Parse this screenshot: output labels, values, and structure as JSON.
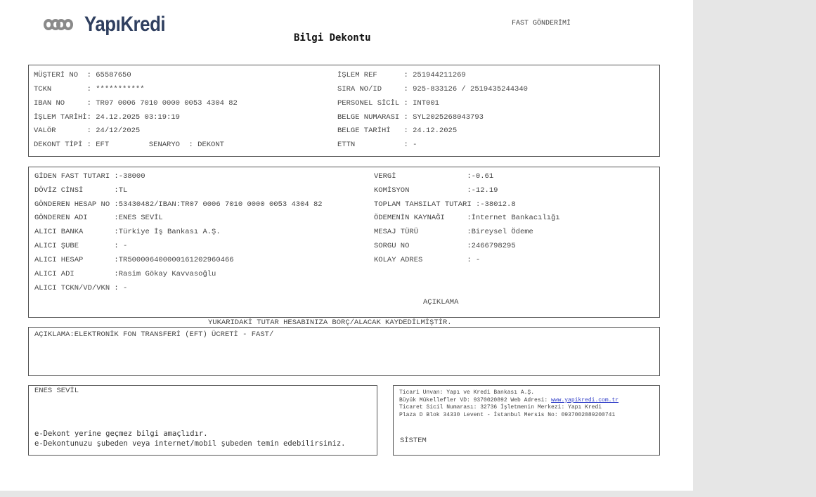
{
  "header": {
    "logo_text": "YapıKredi",
    "title": "Bilgi Dekontu",
    "doc_type": "FAST GÖNDERİMİ"
  },
  "customer": {
    "left": [
      {
        "label": "MÜŞTERİ NO  ",
        "value": ": 65587650"
      },
      {
        "label": "TCKN        ",
        "value": ": ***********"
      },
      {
        "label": "IBAN NO     ",
        "value": ": TR07 0006 7010 0000 0053 4304 82"
      },
      {
        "label": "İŞLEM TARİHİ",
        "value": ": 24.12.2025 03:19:19"
      },
      {
        "label": "VALÖR       ",
        "value": ": 24/12/2025"
      },
      {
        "label": "DEKONT TİPİ ",
        "value": ": EFT         SENARYO  : DEKONT"
      }
    ],
    "right": [
      {
        "label": "İŞLEM REF      ",
        "value": ": 251944211269"
      },
      {
        "label": "SIRA NO/ID     ",
        "value": ": 925-833126 / 2519435244340"
      },
      {
        "label": "PERSONEL SİCİL ",
        "value": ": INT001"
      },
      {
        "label": "BELGE NUMARASI ",
        "value": ": SYL2025268043793"
      },
      {
        "label": "BELGE TARİHİ   ",
        "value": ": 24.12.2025"
      },
      {
        "label": "ETTN           ",
        "value": ": -"
      }
    ]
  },
  "transfer": {
    "left": [
      {
        "label": "GİDEN FAST TUTARI ",
        "value": ":-38000"
      },
      {
        "label": "DÖVİZ CİNSİ       ",
        "value": ":TL"
      },
      {
        "label": "GÖNDEREN HESAP NO ",
        "value": ":53430482/IBAN:TR07 0006 7010 0000 0053 4304 82"
      },
      {
        "label": "GÖNDEREN ADI      ",
        "value": ":ENES SEVİL"
      },
      {
        "label": "ALICI BANKA       ",
        "value": ":Türkiye İş Bankası A.Ş."
      },
      {
        "label": "ALICI ŞUBE        ",
        "value": ": -"
      },
      {
        "label": "ALICI HESAP       ",
        "value": ":TR500006400000161202960466"
      },
      {
        "label": "ALICI ADI         ",
        "value": ":Rasim Gökay Kavvasoğlu"
      },
      {
        "label": "ALICI TCKN/VD/VKN ",
        "value": ": -"
      }
    ],
    "right": [
      {
        "label": "VERGİ                ",
        "value": ":-0.61"
      },
      {
        "label": "KOMİSYON             ",
        "value": ":-12.19"
      },
      {
        "label": "TOPLAM TAHSILAT TUTARI ",
        "value": ":-38012.8"
      },
      {
        "label": "ÖDEMENİN KAYNAĞI     ",
        "value": ":İnternet Bankacılığı"
      },
      {
        "label": "MESAJ TÜRÜ           ",
        "value": ":Bireysel Ödeme"
      },
      {
        "label": "SORGU NO             ",
        "value": ":2466798295"
      },
      {
        "label": "KOLAY ADRES          ",
        "value": ": -"
      }
    ],
    "aciklama_heading": "AÇIKLAMA"
  },
  "notice": "YUKARIDAKİ TUTAR HESABINIZA BORÇ/ALACAK KAYDEDİLMİŞTİR.",
  "description": "AÇIKLAMA:ELEKTRONİK FON TRANSFERİ (EFT) ÜCRETİ - FAST/",
  "footer": {
    "name": "ENES SEVİL",
    "info_line1": "e-Dekont yerine geçmez bilgi amaçlıdır.",
    "info_line2": "e-Dekontunuzu şubeden veya internet/mobil şubeden temin edebilirsiniz.",
    "legal_line1": "Ticari Unvan: Yapı ve Kredi Bankası A.Ş.",
    "legal_line2_prefix": "Büyük Mükellefler VD: 9370020892 Web Adresi: ",
    "legal_link": "www.yapikredi.com.tr",
    "legal_line3": "Ticaret Sicil Numarası: 32736 İşletmenin Merkezi: Yapı Kredi",
    "legal_line4": "Plaza D Blok 34330 Levent - İstanbul Mersis No: 0937002089200741",
    "system": "SİSTEM"
  }
}
